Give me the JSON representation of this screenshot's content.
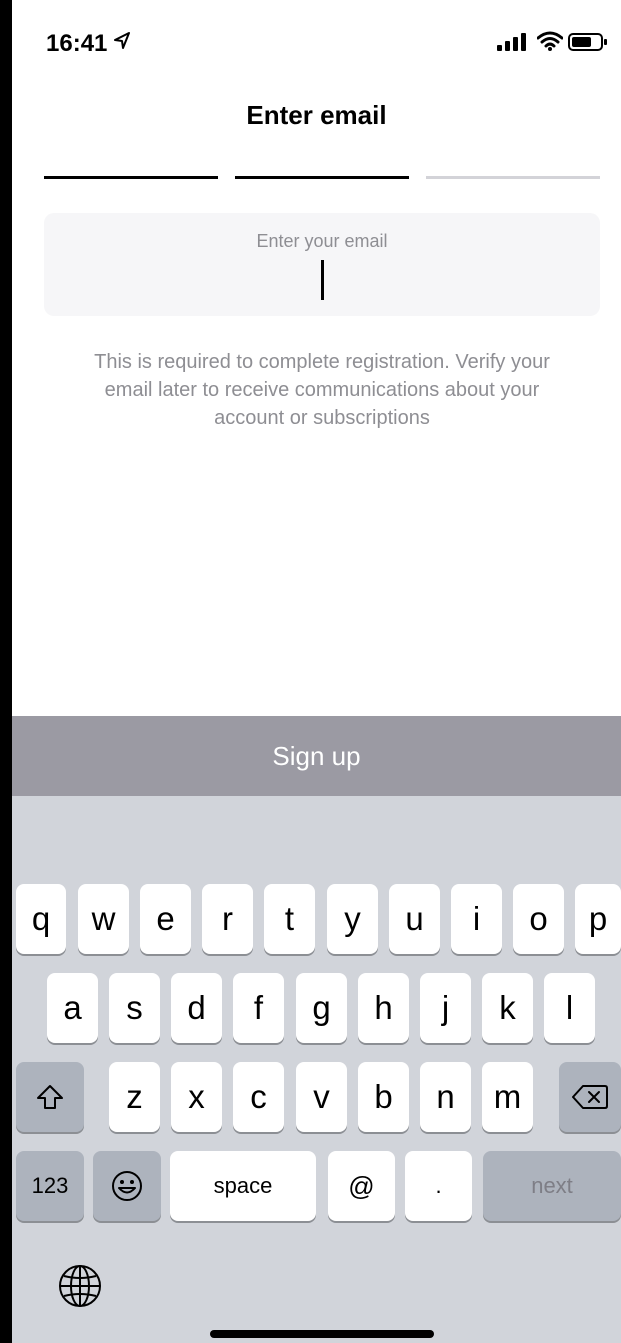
{
  "status_bar": {
    "time": "16:41"
  },
  "header": {
    "title": "Enter email"
  },
  "progress": {
    "steps_total": 3,
    "steps_completed": 2
  },
  "email_field": {
    "placeholder": "Enter your email",
    "value": ""
  },
  "helper_text": "This is required to complete registration. Verify your email later to receive communications about your account or subscriptions",
  "signup_button": {
    "label": "Sign up"
  },
  "keyboard": {
    "row1": [
      "q",
      "w",
      "e",
      "r",
      "t",
      "y",
      "u",
      "i",
      "o",
      "p"
    ],
    "row2": [
      "a",
      "s",
      "d",
      "f",
      "g",
      "h",
      "j",
      "k",
      "l"
    ],
    "row3": [
      "z",
      "x",
      "c",
      "v",
      "b",
      "n",
      "m"
    ],
    "numbers_label": "123",
    "space_label": "space",
    "at_label": "@",
    "dot_label": ".",
    "next_label": "next"
  },
  "icons": {
    "location": "location-arrow-icon",
    "signal": "cellular-signal-icon",
    "wifi": "wifi-icon",
    "battery": "battery-icon",
    "shift": "shift-icon",
    "delete": "delete-icon",
    "emoji": "emoji-icon",
    "globe": "globe-icon"
  }
}
